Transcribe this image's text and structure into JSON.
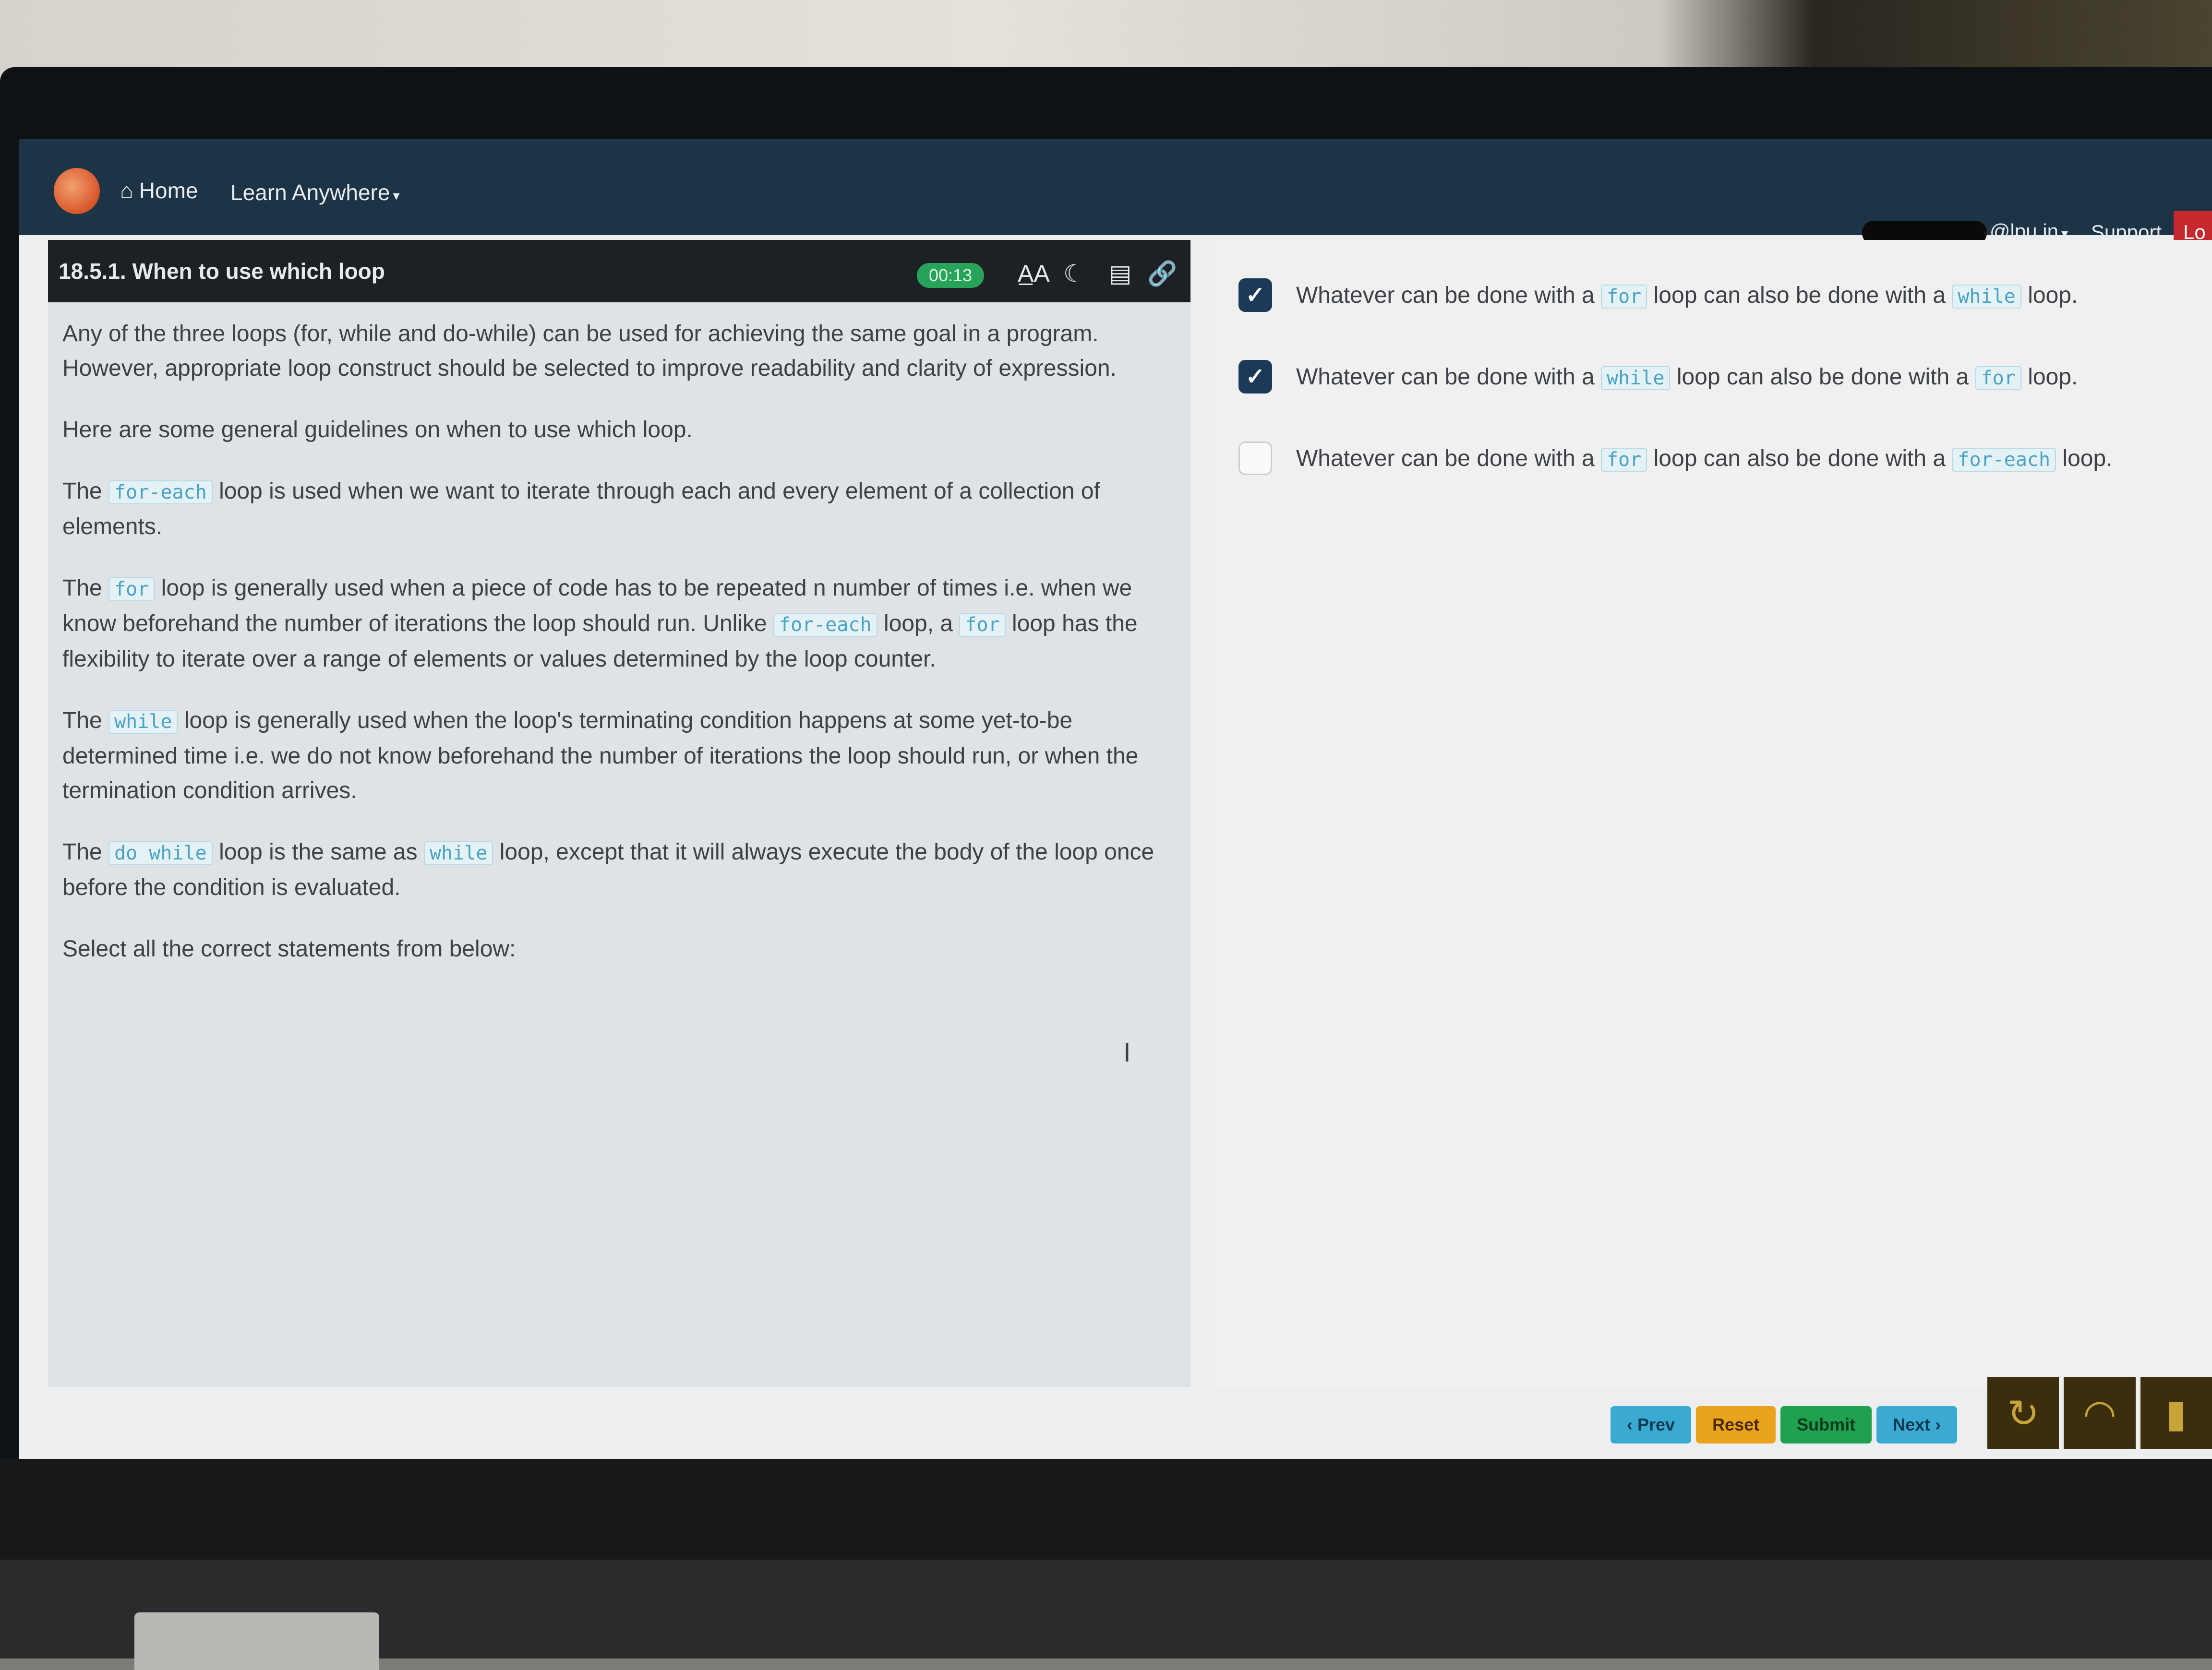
{
  "nav": {
    "home_label": "Home",
    "learn_label": "Learn Anywhere",
    "user_email": "@lpu.in",
    "support_label": "Support",
    "logout_label": "Lo"
  },
  "lesson": {
    "title": "18.5.1. When to use which loop",
    "timer": "00:13",
    "tools": [
      "text-size-icon",
      "dark-mode-icon",
      "layout-icon",
      "link-icon"
    ],
    "paragraphs": {
      "p1": "Any of the three loops (for, while and do-while) can be used for achieving the same goal in a program. However, appropriate loop construct should be selected to improve readability and clarity of expression.",
      "p2": "Here are some general guidelines on when to use which loop.",
      "p3a": "The",
      "p3code": "for-each",
      "p3b": "loop is used when we want to iterate through each and every element of a collection of elements.",
      "p4a": "The",
      "p4code1": "for",
      "p4b": "loop is generally used when a piece of code has to be repeated n number of times i.e. when we know beforehand the number of iterations the loop should run. Unlike",
      "p4code2": "for-each",
      "p4c": "loop, a",
      "p4code3": "for",
      "p4d": "loop has the flexibility to iterate over a range of elements or values determined by the loop counter.",
      "p5a": "The",
      "p5code": "while",
      "p5b": "loop is generally used when the loop's terminating condition happens at some yet-to-be determined time i.e. we do not know beforehand the number of iterations the loop should run, or when the termination condition arrives.",
      "p6a": "The",
      "p6code1": "do while",
      "p6b": "loop is the same as",
      "p6code2": "while",
      "p6c": "loop, except that it will always execute the body of the loop once before the condition is evaluated.",
      "p7": "Select all the correct statements from below:"
    }
  },
  "options": [
    {
      "checked": true,
      "pre": "Whatever can be done with a",
      "code1": "for",
      "mid": "loop can also be done with a",
      "code2": "while",
      "post": "loop."
    },
    {
      "checked": true,
      "pre": "Whatever can be done with a",
      "code1": "while",
      "mid": "loop can also be done with a",
      "code2": "for",
      "post": "loop."
    },
    {
      "checked": false,
      "pre": "Whatever can be done with a",
      "code1": "for",
      "mid": "loop can also be done with a",
      "code2": "for-each",
      "post": "loop."
    }
  ],
  "buttons": {
    "prev": "‹ Prev",
    "reset": "Reset",
    "submit": "Submit",
    "next": "Next ›"
  },
  "taskbar_icons": [
    "refresh-icon",
    "wifi-icon",
    "battery-icon"
  ]
}
